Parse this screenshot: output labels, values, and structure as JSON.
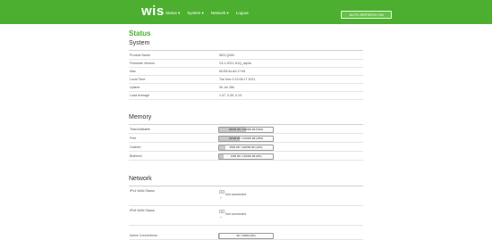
{
  "app": {
    "logo": "wis",
    "auto_refresh_label": "AUTO REFRESH ON"
  },
  "nav": [
    {
      "label": "Status ▾"
    },
    {
      "label": "System ▾"
    },
    {
      "label": "Network ▾"
    },
    {
      "label": "Logout"
    }
  ],
  "page_title": "Status",
  "system": {
    "title": "System",
    "rows": [
      {
        "label": "Product Name",
        "value": "WIS-Q400"
      },
      {
        "label": "Firmware Version",
        "value": "V3.1.2021-H1Q_alpha"
      },
      {
        "label": "Mac",
        "value": "60:E8:5c:a3:17:06"
      },
      {
        "label": "Local Time",
        "value": "Tue Nov 9 22:06:17 2021"
      },
      {
        "label": "Uptime",
        "value": "0h 1m 28s"
      },
      {
        "label": "Load Average",
        "value": "1.07, 0.39, 0.13"
      }
    ]
  },
  "memory": {
    "title": "Memory",
    "rows": [
      {
        "label": "Total Available",
        "text": "93692 kB / 126300 kB (50%)",
        "percent": 50
      },
      {
        "label": "Free",
        "text": "91548 kB / 126300 kB (38%)",
        "percent": 38
      },
      {
        "label": "Cached",
        "text": "3560 kB / 126300 kB (12%)",
        "percent": 12
      },
      {
        "label": "Buffered",
        "text": "1356 kB / 126300 kB (8%)",
        "percent": 8
      }
    ]
  },
  "network": {
    "title": "Network",
    "rows": [
      {
        "label": "IPv4 WAN Status",
        "status": "Not connected",
        "icon_hint": "?"
      },
      {
        "label": "IPv6 WAN Status",
        "status": "Not connected",
        "icon_hint": "?"
      }
    ],
    "connections": {
      "label": "Active Connections",
      "text": "36 / 16384 (0%)",
      "percent": 1
    }
  },
  "colors": {
    "brand": "#4caf2f"
  },
  "icons": {
    "wan": "ethernet-port-icon"
  }
}
